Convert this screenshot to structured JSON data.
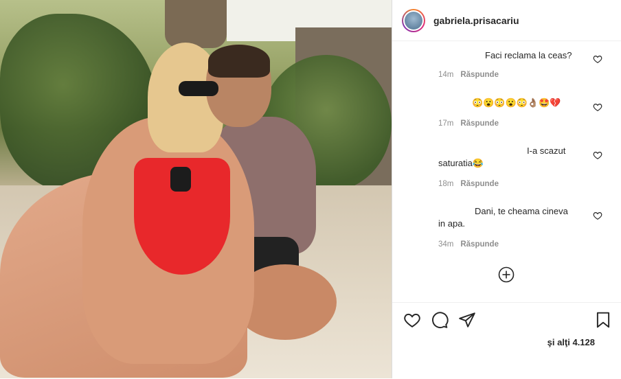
{
  "post": {
    "username": "gabriela.prisacariu"
  },
  "comments": [
    {
      "text": "Faci reclama la ceas?",
      "time": "14m",
      "reply": "Răspunde"
    },
    {
      "text": "😳😮😳😮😳👌🏽🤩💔",
      "time": "17m",
      "reply": "Răspunde"
    },
    {
      "text_line1": "I-a scazut",
      "text_line2": "saturatia😂",
      "time": "18m",
      "reply": "Răspunde"
    },
    {
      "text_line1": "Dani, te cheama cineva",
      "text_line2": "in apa.",
      "time": "34m",
      "reply": "Răspunde"
    }
  ],
  "likes": {
    "text": "şi alţi 4.128"
  },
  "icons": {
    "like": "heart-icon",
    "comment": "comment-icon",
    "share": "paper-plane-icon",
    "save": "bookmark-icon",
    "load_more": "plus-circle-icon",
    "comment_like": "heart-icon"
  }
}
